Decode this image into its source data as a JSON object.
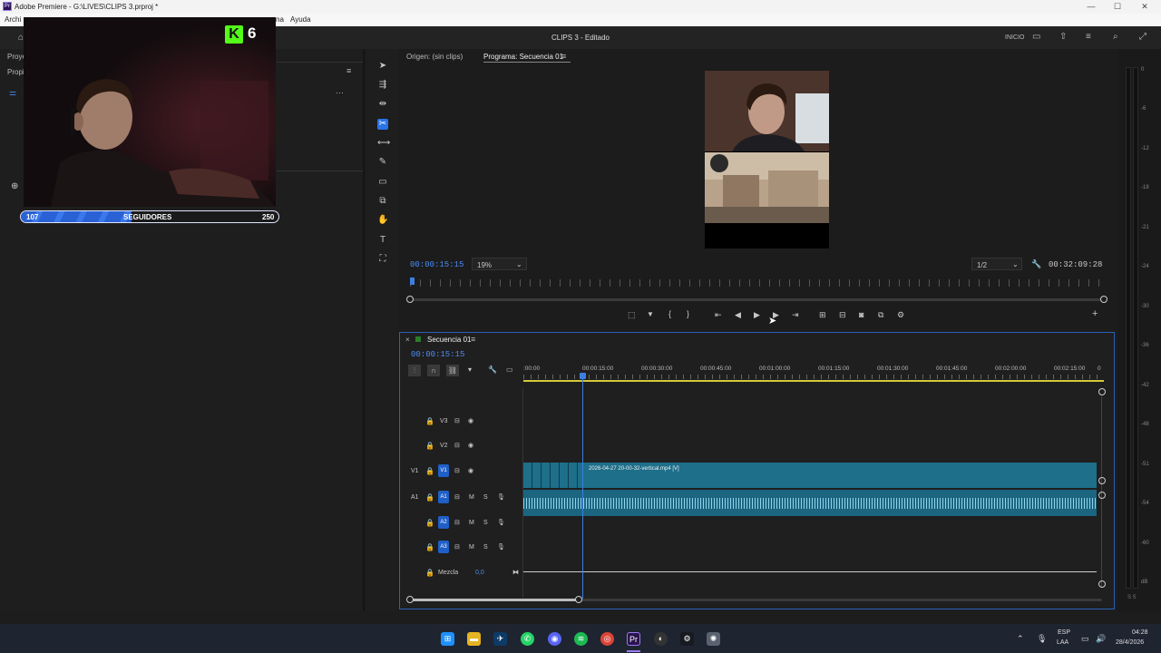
{
  "window": {
    "title": "Adobe Premiere - G:\\LIVES\\CLIPS 3.prproj *",
    "min": "—",
    "max": "☐",
    "close": "✕"
  },
  "menu": {
    "items": [
      "Archi",
      "na",
      "Ayuda"
    ]
  },
  "header": {
    "project_title": "CLIPS 3 - Editado",
    "workspace_label": "INICIO"
  },
  "left_panel": {
    "tab1": "Proye",
    "tab2": "Propi",
    "menu_glyph": "≡",
    "more_glyph": "···"
  },
  "overlay": {
    "badge_count": "6",
    "followers_current": "107",
    "followers_label": "SEGUIDORES",
    "followers_goal": "250",
    "progress_fraction": 0.428
  },
  "monitor": {
    "source_tab": "Origen: (sin clips)",
    "program_tab": "Programa: Secuencia 01",
    "timecode": "00:00:15:15",
    "zoom": "19%",
    "resolution": "1/2",
    "duration": "00:32:09:28"
  },
  "timeline": {
    "sequence_tab": "Secuencia 01",
    "timecode": "00:00:15:15",
    "ruler": [
      ":00:00",
      "00:00:15:00",
      "00:00:30:00",
      "00:00:45:00",
      "00:01:00:00",
      "00:01:15:00",
      "00:01:30:00",
      "00:01:45:00",
      "00:02:00:00",
      "00:02:15:00",
      "0"
    ],
    "tracks": [
      {
        "src": "",
        "name": "V3",
        "type": "video"
      },
      {
        "src": "",
        "name": "V2",
        "type": "video"
      },
      {
        "src": "V1",
        "name": "V1",
        "type": "video"
      },
      {
        "src": "A1",
        "name": "A1",
        "type": "audio"
      },
      {
        "src": "",
        "name": "A2",
        "type": "audio"
      },
      {
        "src": "",
        "name": "A3",
        "type": "audio"
      }
    ],
    "mix_label": "Mezcla",
    "mix_value": "0,0",
    "clip_name": "2026-04-27 20-00-32-vertical.mp4 [V]",
    "m_label": "M",
    "s_label": "S"
  },
  "meters": {
    "scale": [
      "0",
      "-6",
      "-12",
      "-18",
      "-21",
      "-24",
      "-30",
      "-36",
      "-42",
      "-48",
      "-51",
      "-54",
      "-60",
      "dB"
    ],
    "bottom": "S S"
  },
  "taskbar": {
    "lang": "ESP",
    "region": "LAA",
    "time": "04:28",
    "date": "28/4/2026"
  },
  "colors": {
    "accent": "#2a73e8",
    "clip": "#1d6f8a",
    "timecode": "#4c8bf5",
    "playhead": "#3d7fe0"
  }
}
